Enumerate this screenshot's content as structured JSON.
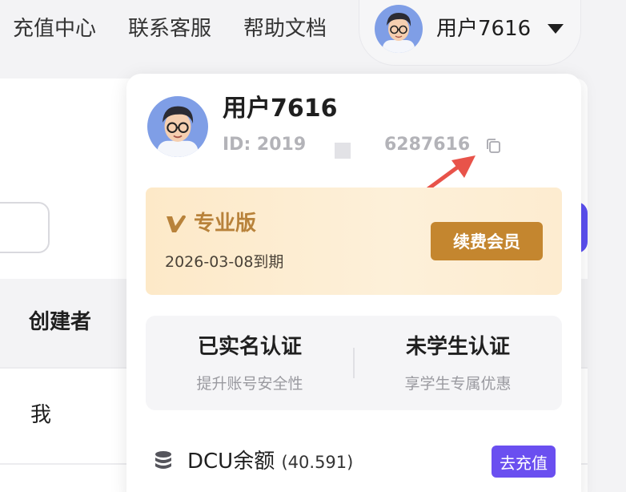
{
  "nav": {
    "recharge": "充值中心",
    "support": "联系客服",
    "docs": "帮助文档"
  },
  "user": {
    "pill_name": "用户7616",
    "name": "用户7616",
    "id_prefix": "ID: 2019",
    "id_suffix": "6287616"
  },
  "background": {
    "column_creator": "创建者",
    "cell_me": "我"
  },
  "membership": {
    "tier": "专业版",
    "expiry": "2026-03-08到期",
    "renew_label": "续费会员"
  },
  "verification": {
    "realname_title": "已实名认证",
    "realname_sub": "提升账号安全性",
    "student_title": "未学生认证",
    "student_sub": "享学生专属优惠"
  },
  "balance": {
    "label": "DCU余额",
    "value": "(40.591)",
    "recharge_label": "去充值"
  },
  "colors": {
    "accent_purple": "#6a4ff0",
    "vip_gold": "#c4862f",
    "annotation_arrow": "#e8534a"
  },
  "icons": [
    "avatar",
    "caret-down-icon",
    "copy-icon",
    "vip-v-icon",
    "database-icon",
    "arrow-annotation"
  ]
}
